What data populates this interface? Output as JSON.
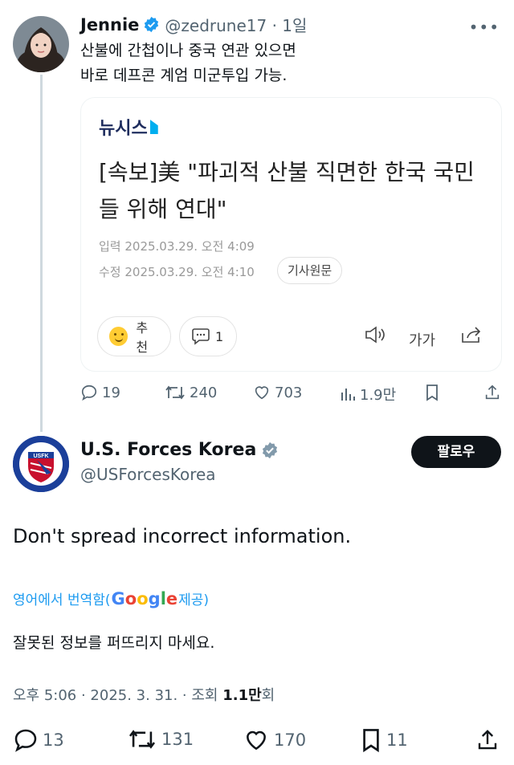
{
  "tweet1": {
    "name": "Jennie",
    "handle": "@zedrune17 · 1일",
    "more_icon": "more-icon",
    "text_line1": "산불에 간첩이나 중국 연관 있으면",
    "text_line2": "바로 데프콘 계엄 미군투입 가능.",
    "card": {
      "source": "뉴시스",
      "headline": "[속보]美 \"파괴적 산불 직면한 한국 국민들 위해 연대\"",
      "input_time": "입력 2025.03.29. 오전 4:09",
      "edit_time": "수정 2025.03.29. 오전 4:10",
      "original_button": "기사원문",
      "recommend_label": "추천",
      "comment_count": "1",
      "font_size_label": "가가"
    },
    "stats": {
      "replies": "19",
      "retweets": "240",
      "likes": "703",
      "views": "1.9만"
    }
  },
  "tweet2": {
    "name": "U.S. Forces Korea",
    "handle": "@USForcesKorea",
    "follow_label": "팔로우",
    "avatar_text": "USFK",
    "text": "Don't spread incorrect information.",
    "translate_prefix": "영어에서 번역함(",
    "translate_suffix": " 제공)",
    "translated_text": "잘못된 정보를 퍼뜨리지 마세요.",
    "time_prefix": "오후 5:06 · 2025. 3. 31. · 조회 ",
    "view_count": "1.1만",
    "view_suffix": "회",
    "stats": {
      "replies": "13",
      "retweets": "131",
      "likes": "170",
      "bookmarks": "11"
    }
  },
  "colors": {
    "accent": "#1d9bf0",
    "text": "#0f1419",
    "muted": "#536471",
    "border": "#eff3f4"
  }
}
